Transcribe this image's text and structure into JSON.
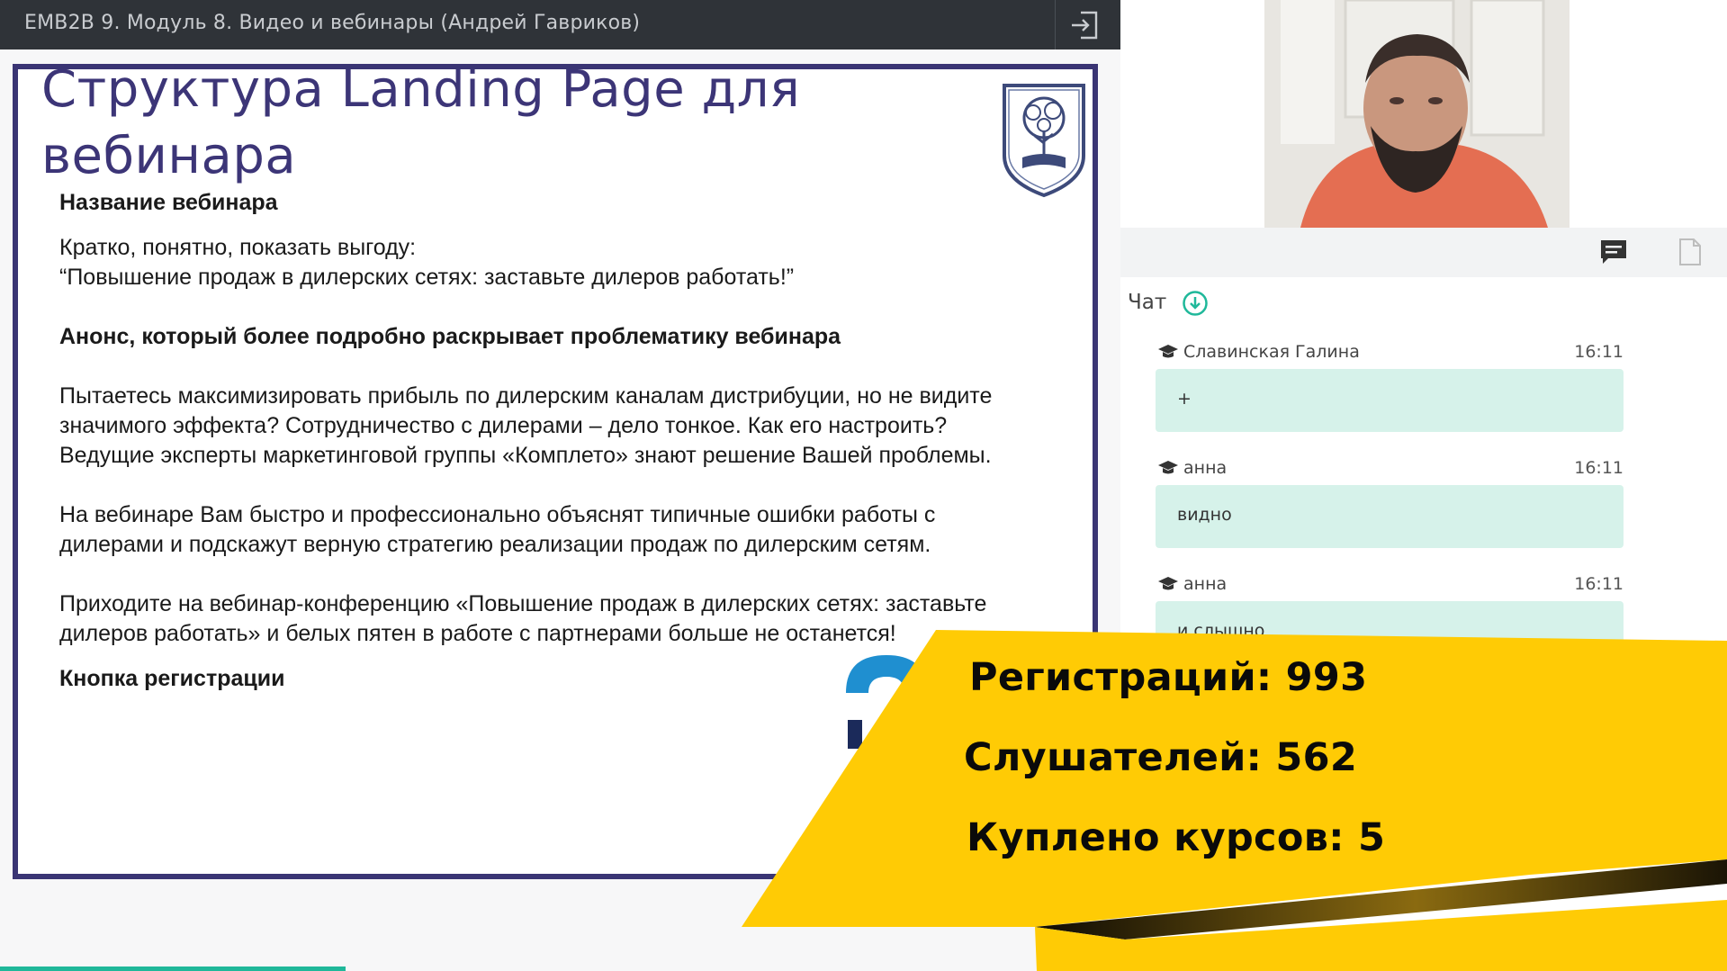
{
  "window": {
    "title": "EMB2B 9. Модуль 8. Видео и вебинары (Андрей Гавриков)",
    "exit_icon": "exit-icon"
  },
  "slide": {
    "heading_line1": "Структура Landing Page для",
    "heading_line2": "вебинара",
    "logo_icon": "tree-shield-logo",
    "section1_title": "Название вебинара",
    "section1_text1": "Кратко, понятно, показать выгоду:",
    "section1_text2": "“Повышение продаж в дилерских сетях: заставьте дилеров работать!”",
    "section2_title": "Анонс, который более подробно раскрывает проблематику вебинара",
    "para1_line1": "Пытаетесь максимизировать прибыль по дилерским каналам дистрибуции, но не видите",
    "para1_line2": "значимого эффекта? Сотрудничество с дилерами – дело тонкое. Как его настроить?",
    "para1_line3": "Ведущие эксперты маркетинговой группы «Комплето» знают решение Вашей проблемы.",
    "para2_line1": "На вебинаре Вам быстро и профессионально объяснят типичные ошибки работы с",
    "para2_line2": "дилерами и подскажут верную стратегию реализации продаж по дилерским сетям.",
    "para3_line1": "Приходите на вебинар-конференцию «Повышение продаж в дилерских сетях: заставьте",
    "para3_line2": "дилеров работать» и белых пятен в работе с партнерами больше не останется!",
    "section3_title": "Кнопка регистрации"
  },
  "panel": {
    "chat_tab_icon": "chat-icon",
    "files_tab_icon": "document-icon",
    "chat_title": "Чат",
    "chat_scroll_icon": "arrow-down-circle-icon",
    "messages": [
      {
        "author": "Славинская Галина",
        "time": "16:11",
        "text": "+"
      },
      {
        "author": "анна",
        "time": "16:11",
        "text": "видно"
      },
      {
        "author": "анна",
        "time": "16:11",
        "text": "и слышно"
      }
    ]
  },
  "overlay": {
    "registrations": "Регистраций: 993",
    "listeners": "Слушателей: 562",
    "courses": "Куплено курсов: 5",
    "colors": {
      "yellow": "#ffcb05",
      "dark": "#1a1405"
    }
  },
  "progress": {
    "fraction": 0.2
  }
}
